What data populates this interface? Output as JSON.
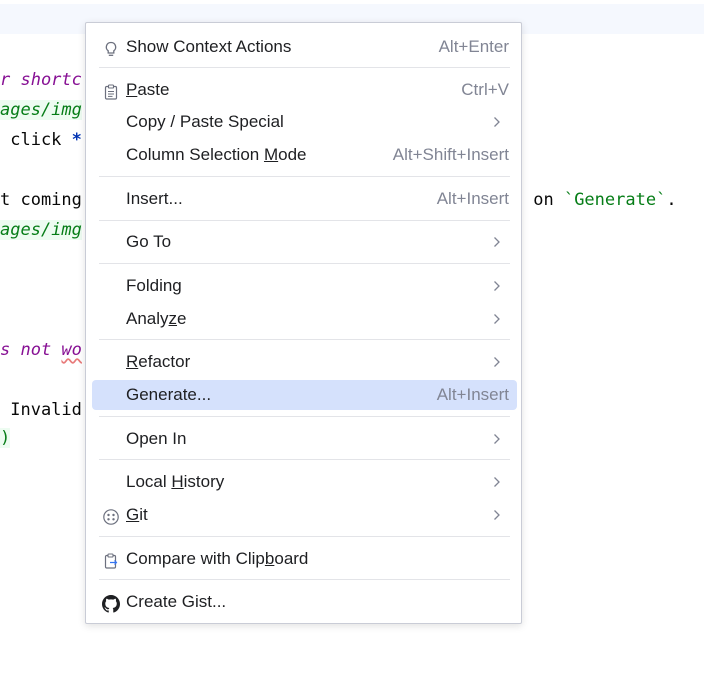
{
  "editor": {
    "lines": [
      {
        "id": "l1",
        "text": "r shortc"
      },
      {
        "id": "l2",
        "text": "ages/img"
      },
      {
        "id": "l3a",
        "text": " click "
      },
      {
        "id": "l3b",
        "text": "*"
      },
      {
        "id": "l4",
        "text": "t coming"
      },
      {
        "id": "l4b",
        "text": " on "
      },
      {
        "id": "l4c",
        "text": "`Generate`"
      },
      {
        "id": "l4d",
        "text": "."
      },
      {
        "id": "l5",
        "text": "ages/img"
      },
      {
        "id": "l6a",
        "text": "s not "
      },
      {
        "id": "l6b",
        "text": "wo"
      },
      {
        "id": "l7",
        "text": " Invalid"
      },
      {
        "id": "l8",
        "text": ")"
      }
    ]
  },
  "menu": {
    "items": [
      {
        "label": "Show Context Actions",
        "shortcut": "Alt+Enter",
        "icon": "lightbulb-icon"
      },
      {
        "label_pre": "",
        "label_u": "P",
        "label_post": "aste",
        "shortcut": "Ctrl+V",
        "icon": "clipboard-icon"
      },
      {
        "label": "Copy / Paste Special",
        "icon": "chevron-right-icon"
      },
      {
        "label_pre": "Column Selection ",
        "label_u": "M",
        "label_post": "ode",
        "shortcut": "Alt+Shift+Insert"
      },
      {
        "label": "Insert...",
        "shortcut": "Alt+Insert"
      },
      {
        "label": "Go To"
      },
      {
        "label": "Folding"
      },
      {
        "label_pre": "Analy",
        "label_u": "z",
        "label_post": "e"
      },
      {
        "label_pre": "",
        "label_u": "R",
        "label_post": "efactor"
      },
      {
        "label": "Generate...",
        "shortcut": "Alt+Insert",
        "selected": true
      },
      {
        "label": "Open In"
      },
      {
        "label_pre": "Local ",
        "label_u": "H",
        "label_post": "istory"
      },
      {
        "label_pre": "",
        "label_u": "G",
        "label_post": "it",
        "icon": "git-icon"
      },
      {
        "label_pre": "Compare with Clip",
        "label_u": "b",
        "label_post": "oard",
        "icon": "compare-clipboard-icon"
      },
      {
        "label": "Create Gist...",
        "icon": "github-icon"
      }
    ]
  }
}
